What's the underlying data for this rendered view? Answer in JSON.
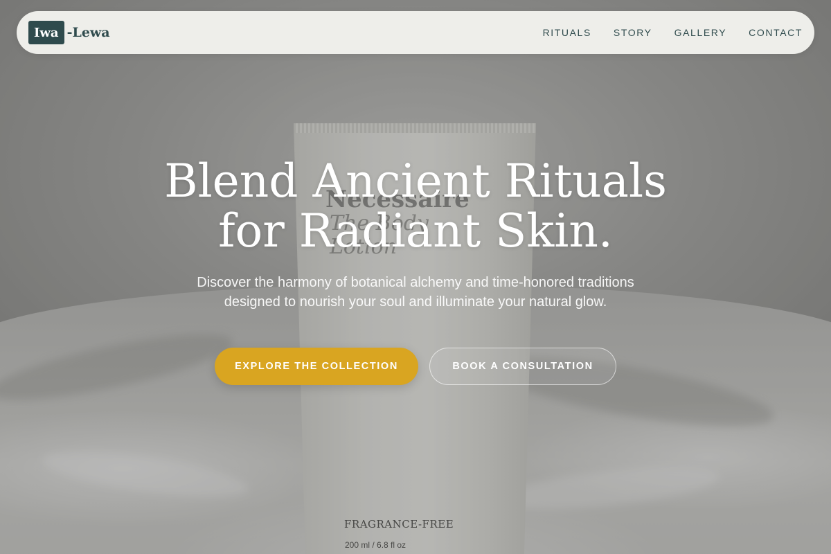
{
  "brand": {
    "logo_mark": "Iwa",
    "logo_rest": "-Lewa"
  },
  "nav": {
    "links": [
      "RITUALS",
      "STORY",
      "GALLERY",
      "CONTACT"
    ]
  },
  "hero": {
    "headline_line1": "Blend Ancient Rituals",
    "headline_line2": "for Radiant Skin.",
    "subtitle": "Discover the harmony of botanical alchemy and time-honored traditions designed to nourish your soul and illuminate your natural glow.",
    "primary_cta": "EXPLORE THE COLLECTION",
    "secondary_cta": "BOOK A CONSULTATION"
  },
  "background_image": {
    "product_brand": "Necessaire",
    "product_name": "The Body Lotion",
    "product_label": "FRAGRANCE-FREE",
    "product_volume": "200 ml / 6.8 fl oz"
  },
  "colors": {
    "accent": "#d9a521",
    "brand": "#2f4b4d"
  }
}
